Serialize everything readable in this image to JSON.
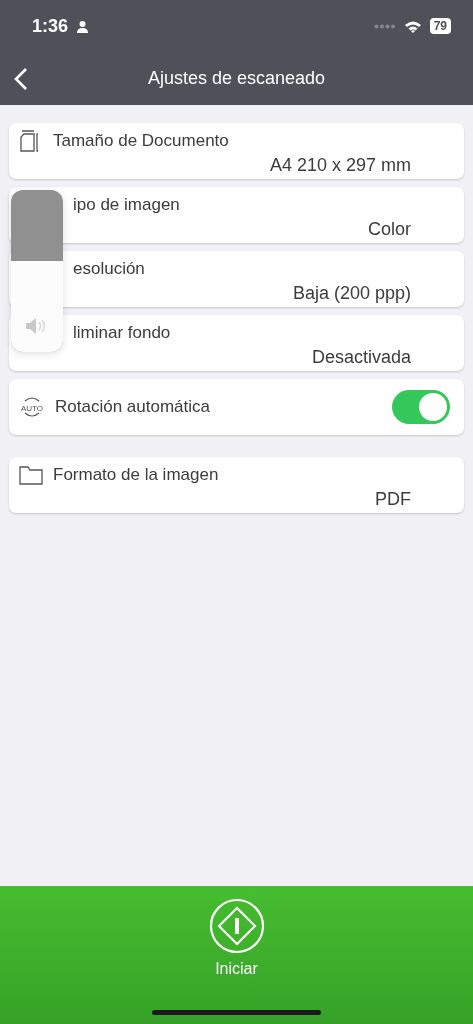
{
  "status_bar": {
    "time": "1:36",
    "battery": "79"
  },
  "nav": {
    "title": "Ajustes de escaneado"
  },
  "groups": [
    [
      {
        "kind": "value",
        "label": "Tamaño de Documento",
        "value": "A4 210 x 297 mm"
      },
      {
        "kind": "value",
        "label": "ipo de imagen",
        "value": "Color"
      },
      {
        "kind": "value",
        "label": "esolución",
        "value": "Baja (200 ppp)"
      },
      {
        "kind": "value",
        "label": "liminar fondo",
        "value": "Desactivada"
      },
      {
        "kind": "toggle",
        "icon_text": "AUTO",
        "label": "Rotación automática",
        "on": true
      }
    ],
    [
      {
        "kind": "value",
        "label": "Formato de la imagen",
        "value": "PDF"
      }
    ]
  ],
  "volume_hud": {
    "level": 0.56
  },
  "start_button": {
    "label": "Iniciar"
  }
}
